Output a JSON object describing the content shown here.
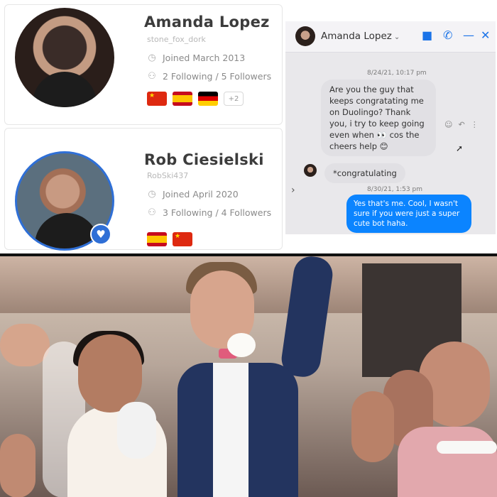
{
  "profiles": [
    {
      "name": "Amanda Lopez",
      "username": "stone_fox_dork",
      "joined": "Joined March 2013",
      "follow": "2 Following / 5 Followers",
      "more_languages": "+2"
    },
    {
      "name": "Rob Ciesielski",
      "username": "RobSki437",
      "joined": "Joined April 2020",
      "follow": "3 Following / 4 Followers"
    }
  ],
  "chat": {
    "title": "Amanda Lopez",
    "timestamp_1": "8/24/21, 10:17 pm",
    "message_1": "Are you the guy that keeps congratating me on Duolingo? Thank you, i try to keep going even when 👀 cos the cheers help 😊",
    "message_2": "*congratulating",
    "timestamp_2": "8/30/21, 1:53 pm",
    "message_3": "Yes that's me. Cool, I wasn't sure if you were just a super cute bot haha."
  },
  "colors": {
    "accent_blue": "#2f6fd6",
    "messenger_blue": "#0b84ff",
    "flag_cn": "#de2910",
    "flag_es": "#c60b1e"
  },
  "icons": {
    "clock": "clock-icon",
    "people": "people-icon",
    "heart": "heart-icon",
    "video": "video-icon",
    "phone": "phone-icon"
  }
}
